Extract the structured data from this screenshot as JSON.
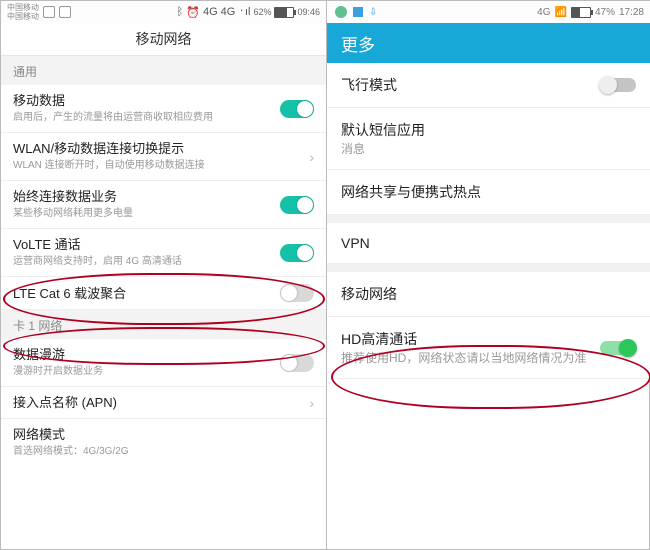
{
  "left": {
    "status": {
      "carrier1": "中国移动",
      "carrier2": "中国移动",
      "net1": "4G",
      "net2": "4G",
      "signal": "᛫ıl",
      "battery_pct": "62%",
      "battery_fill": 62,
      "time": "09:46"
    },
    "title": "移动网络",
    "section1": "通用",
    "items": [
      {
        "title": "移动数据",
        "sub": "启用后，产生的流量将由运营商收取相应费用",
        "toggle": true
      },
      {
        "title": "WLAN/移动数据连接切换提示",
        "sub": "WLAN 连接断开时，自动使用移动数据连接"
      },
      {
        "title": "始终连接数据业务",
        "sub": "某些移动网络耗用更多电量",
        "toggle": true
      },
      {
        "title": "VoLTE 通话",
        "sub": "运营商网络支持时，启用 4G 高清通话",
        "toggle": true
      },
      {
        "title": "LTE Cat 6 载波聚合",
        "toggle": false
      }
    ],
    "section2": "卡 1 网络",
    "items2": [
      {
        "title": "数据漫游",
        "sub": "漫游时开启数据业务",
        "toggle": false
      },
      {
        "title": "接入点名称 (APN)"
      },
      {
        "title": "网络模式",
        "sub": "首选网络模式：4G/3G/2G"
      }
    ]
  },
  "right": {
    "status": {
      "net": "4G",
      "battery_pct": "47%",
      "battery_fill": 47,
      "time": "17:28"
    },
    "title": "更多",
    "items": [
      {
        "title": "飞行模式",
        "toggle": false
      },
      {
        "title": "默认短信应用",
        "sub": "消息"
      },
      {
        "title": "网络共享与便携式热点"
      },
      {
        "title": "VPN"
      },
      {
        "title": "移动网络"
      },
      {
        "title": "HD高清通话",
        "sub": "推荐使用HD，网络状态请以当地网络情况为准",
        "toggle": true
      }
    ]
  }
}
